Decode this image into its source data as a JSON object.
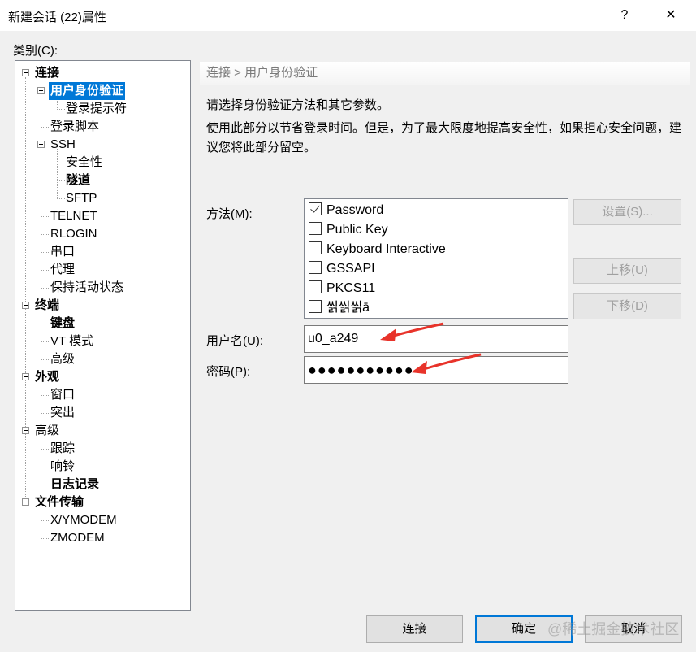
{
  "window": {
    "title": "新建会话 (22)属性",
    "help": "?",
    "close": "✕"
  },
  "category_label": "类别(C):",
  "tree": {
    "items": [
      {
        "label": "连接"
      },
      {
        "label": "用户身份验证"
      },
      {
        "label": "登录提示符"
      },
      {
        "label": "登录脚本"
      },
      {
        "label": "SSH"
      },
      {
        "label": "安全性"
      },
      {
        "label": "隧道"
      },
      {
        "label": "SFTP"
      },
      {
        "label": "TELNET"
      },
      {
        "label": "RLOGIN"
      },
      {
        "label": "串口"
      },
      {
        "label": "代理"
      },
      {
        "label": "保持活动状态"
      },
      {
        "label": "终端"
      },
      {
        "label": "键盘"
      },
      {
        "label": "VT 模式"
      },
      {
        "label": "高级"
      },
      {
        "label": "外观"
      },
      {
        "label": "窗口"
      },
      {
        "label": "突出"
      },
      {
        "label": "高级"
      },
      {
        "label": "跟踪"
      },
      {
        "label": "响铃"
      },
      {
        "label": "日志记录"
      },
      {
        "label": "文件传输"
      },
      {
        "label": "X/YMODEM"
      },
      {
        "label": "ZMODEM"
      }
    ]
  },
  "panel": {
    "breadcrumb": "连接 > 用户身份验证",
    "desc1": "请选择身份验证方法和其它参数。",
    "desc2": "使用此部分以节省登录时间。但是，为了最大限度地提高安全性，如果担心安全问题，建议您将此部分留空。",
    "method_label": "方法(M):",
    "methods": [
      {
        "label": "Password",
        "checked": true
      },
      {
        "label": "Public Key",
        "checked": false
      },
      {
        "label": "Keyboard Interactive",
        "checked": false
      },
      {
        "label": "GSSAPI",
        "checked": false
      },
      {
        "label": "PKCS11",
        "checked": false
      },
      {
        "label": "씱씱씱ā",
        "checked": false
      }
    ],
    "settings_button": "设置(S)...",
    "move_up_button": "上移(U)",
    "move_down_button": "下移(D)",
    "username_label": "用户名(U):",
    "username_value": "u0_a249",
    "password_label": "密码(P):",
    "password_value": "●●●●●●●●●●●"
  },
  "footer": {
    "connect_button": "连接",
    "ok_button": "确定",
    "cancel_button": "取消"
  },
  "watermark": "@稀土掘金技术社区",
  "colors": {
    "selection": "#0078d7",
    "arrow": "#e8332a"
  }
}
